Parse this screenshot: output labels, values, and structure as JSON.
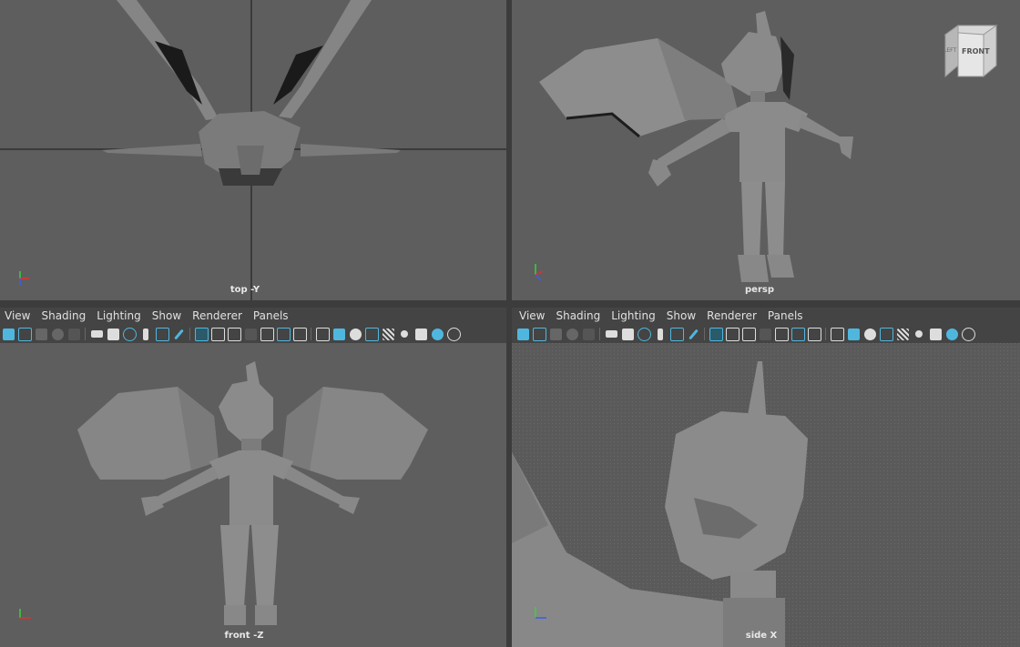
{
  "viewports": {
    "top": {
      "label": "top -Y"
    },
    "persp": {
      "label": "persp"
    },
    "front": {
      "label": "front -Z"
    },
    "side": {
      "label": "side X"
    }
  },
  "menus": {
    "left": [
      "View",
      "Shading",
      "Lighting",
      "Show",
      "Renderer",
      "Panels"
    ],
    "right": [
      "View",
      "Shading",
      "Lighting",
      "Show",
      "Renderer",
      "Panels"
    ]
  },
  "viewcube": {
    "front_label": "FRONT",
    "left_label": "LEFT"
  },
  "axis_labels": {
    "x": "x",
    "y": "y",
    "z": "z"
  },
  "colors": {
    "viewport_bg": "#5e5e5e",
    "ui_bg": "#444444",
    "model_gray": "#8a8a8a",
    "accent_blue": "#4fb7de",
    "axis_x": "#e03030",
    "axis_y": "#3ad13a",
    "axis_z": "#3a5ee8"
  }
}
